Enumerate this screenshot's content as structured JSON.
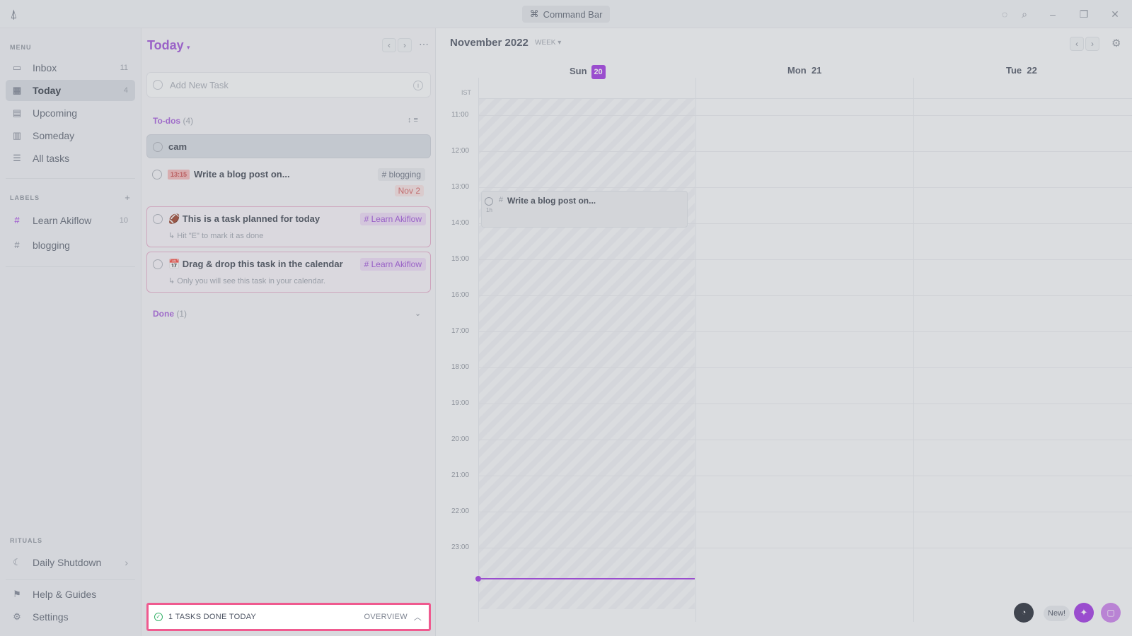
{
  "titlebar": {
    "command_bar_label": "Command Bar"
  },
  "sidebar": {
    "menu_title": "MENU",
    "items": [
      {
        "label": "Inbox",
        "count": "11",
        "icon": "inbox-icon"
      },
      {
        "label": "Today",
        "count": "4",
        "icon": "calendar-today-icon"
      },
      {
        "label": "Upcoming",
        "count": "",
        "icon": "calendar-upcoming-icon"
      },
      {
        "label": "Someday",
        "count": "",
        "icon": "calendar-someday-icon"
      },
      {
        "label": "All tasks",
        "count": "",
        "icon": "list-icon"
      }
    ],
    "labels_title": "LABELS",
    "labels": [
      {
        "label": "Learn Akiflow",
        "count": "10",
        "color": "#9b30e0"
      },
      {
        "label": "blogging",
        "count": "",
        "color": "#8a909a"
      }
    ],
    "rituals_title": "RITUALS",
    "ritual_item": "Daily Shutdown",
    "help_label": "Help & Guides",
    "settings_label": "Settings"
  },
  "tasks": {
    "title": "Today",
    "add_placeholder": "Add New Task",
    "todos_label": "To-dos",
    "todos_count": "(4)",
    "todos_sort": "↕ ≡",
    "items": [
      {
        "title": "cam",
        "subtitle": "",
        "label": ""
      },
      {
        "title": "Write a blog post on...",
        "time": "13:15",
        "label": "# blogging",
        "date": "Nov 2"
      },
      {
        "title": "🏈 This is a task planned for today",
        "subtitle": "↳ Hit \"E\" to mark it as done",
        "label": "# Learn Akiflow"
      },
      {
        "title": "📅 Drag & drop this task in the calendar",
        "subtitle": "↳ Only you will see this task in your calendar.",
        "label": "# Learn Akiflow"
      }
    ],
    "done_label": "Done",
    "done_count": "(1)",
    "footer": {
      "text": "1 TASKS DONE TODAY",
      "overview": "OVERVIEW"
    }
  },
  "calendar": {
    "month_title": "November 2022",
    "view_label": "WEEK ▾",
    "timezone": "IST",
    "days": [
      {
        "name": "Sun",
        "num": "20"
      },
      {
        "name": "Mon",
        "num": "21"
      },
      {
        "name": "Tue",
        "num": "22"
      }
    ],
    "hours": [
      "11:00",
      "12:00",
      "13:00",
      "14:00",
      "15:00",
      "16:00",
      "17:00",
      "18:00",
      "19:00",
      "20:00",
      "21:00",
      "22:00",
      "23:00"
    ],
    "event": {
      "tag": "#",
      "title": "Write a blog post on...",
      "duration": "1h"
    },
    "new_label": "New!"
  },
  "colors": {
    "accent": "#9b30e0",
    "focus_border": "#ef5a8f",
    "success": "#37b36a"
  }
}
